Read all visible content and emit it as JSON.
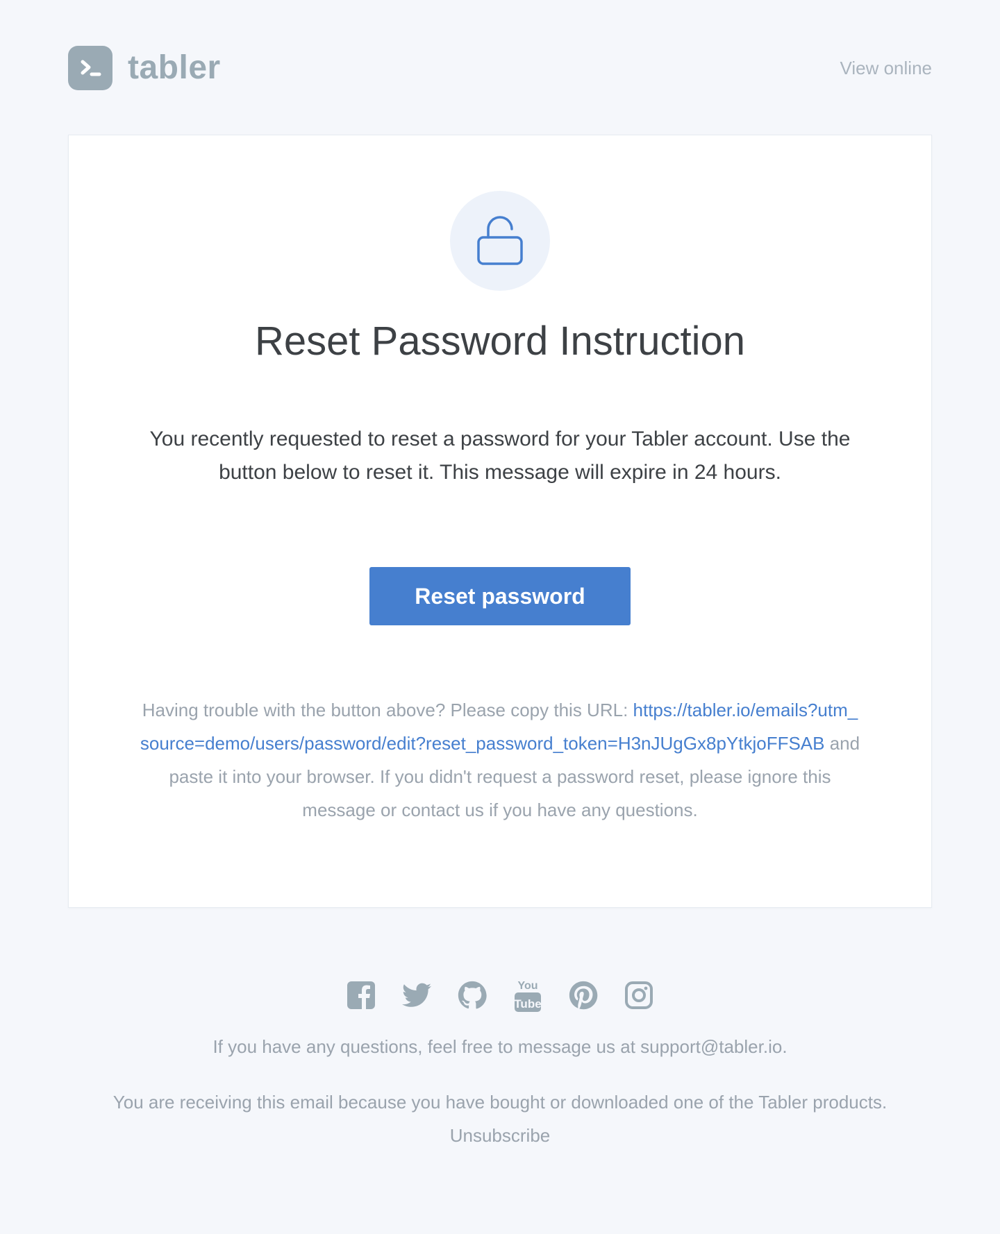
{
  "header": {
    "brand_name": "tabler",
    "view_online": "View online"
  },
  "card": {
    "title": "Reset Password Instruction",
    "intro": "You recently requested to reset a password for your Tabler account. Use the button below to reset it. This message will expire in 24 hours.",
    "button_label": "Reset password",
    "help_prefix": "Having trouble with the button above? Please copy this URL: ",
    "help_url": "https://tabler.io/emails?utm_source=demo/users/password/edit?reset_password_token=H3nJUgGx8pYtkjoFFSAB",
    "help_suffix": " and paste it into your browser. If you didn't request a password reset, please ignore this message or contact us if you have any questions."
  },
  "footer": {
    "social_icons": [
      "facebook-icon",
      "twitter-icon",
      "github-icon",
      "youtube-icon",
      "pinterest-icon",
      "instagram-icon"
    ],
    "questions": "If you have any questions, feel free to message us at support@tabler.io.",
    "receiving": "You are receiving this email because you have bought or downloaded one of the Tabler products.",
    "unsubscribe": "Unsubscribe"
  },
  "colors": {
    "accent": "#467fcf",
    "muted": "#9aa3ad",
    "background": "#f5f7fb"
  }
}
